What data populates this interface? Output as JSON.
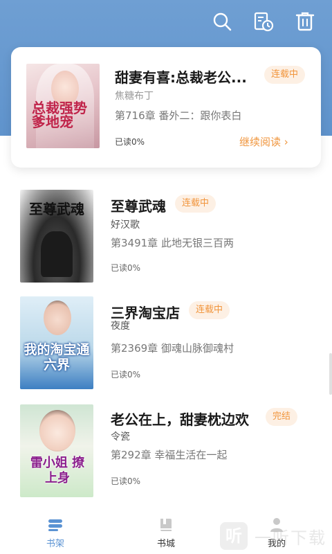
{
  "header": {
    "icons": [
      "search-icon",
      "history-icon",
      "trash-icon"
    ]
  },
  "featured": {
    "title": "甜妻有喜:总裁老公...",
    "status": "连载中",
    "author": "焦糖布丁",
    "chapter": "第716章 番外二：跟你表白",
    "progress": "已读0%",
    "continue_label": "继续阅读 ›",
    "cover_text": "总裁强势爹地宠"
  },
  "books": [
    {
      "title": "至尊武魂",
      "status": "连载中",
      "author": "好汉歌",
      "chapter": "第3491章 此地无银三百两",
      "progress": "已读0%",
      "cover_text": "至尊武魂"
    },
    {
      "title": "三界淘宝店",
      "status": "连载中",
      "author": "夜度",
      "chapter": "第2369章 御魂山脉御魂村",
      "progress": "已读0%",
      "cover_text": "我的淘宝通六界"
    },
    {
      "title": "老公在上，甜妻枕边欢",
      "status": "完结",
      "author": "令瓷",
      "chapter": "第292章 幸福生活在一起",
      "progress": "已读0%",
      "cover_text": "雷小姐 撩上身"
    }
  ],
  "nav": {
    "items": [
      {
        "label": "书架",
        "active": true
      },
      {
        "label": "书城",
        "active": false
      },
      {
        "label": "我的",
        "active": false
      }
    ],
    "active_color": "#5b93d3",
    "inactive_color": "#333333"
  },
  "watermark": {
    "logo": "听",
    "text": "一听下载"
  }
}
